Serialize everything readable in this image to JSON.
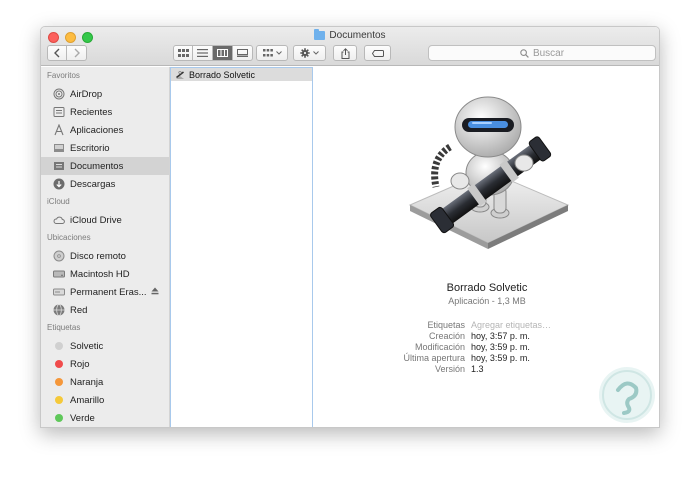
{
  "window": {
    "title": "Documentos"
  },
  "search": {
    "placeholder": "Buscar"
  },
  "sidebar": {
    "favoritos": {
      "header": "Favoritos",
      "items": [
        {
          "label": "AirDrop",
          "icon": "airdrop-icon"
        },
        {
          "label": "Recientes",
          "icon": "recents-icon"
        },
        {
          "label": "Aplicaciones",
          "icon": "applications-icon"
        },
        {
          "label": "Escritorio",
          "icon": "desktop-icon"
        },
        {
          "label": "Documentos",
          "icon": "documents-icon",
          "selected": true
        },
        {
          "label": "Descargas",
          "icon": "downloads-icon"
        }
      ]
    },
    "icloud": {
      "header": "iCloud",
      "items": [
        {
          "label": "iCloud Drive",
          "icon": "cloud-icon"
        }
      ]
    },
    "ubicaciones": {
      "header": "Ubicaciones",
      "items": [
        {
          "label": "Disco remoto",
          "icon": "disc-icon"
        },
        {
          "label": "Macintosh HD",
          "icon": "hard-drive-icon"
        },
        {
          "label": "Permanent Eras...",
          "icon": "drive-icon"
        },
        {
          "label": "Red",
          "icon": "network-icon"
        }
      ]
    },
    "etiquetas": {
      "header": "Etiquetas",
      "items": [
        {
          "label": "Solvetic",
          "color": "#d0d0d0"
        },
        {
          "label": "Rojo",
          "color": "#f04b4b"
        },
        {
          "label": "Naranja",
          "color": "#f5973a"
        },
        {
          "label": "Amarillo",
          "color": "#f5c93a"
        },
        {
          "label": "Verde",
          "color": "#5fc85a"
        }
      ]
    }
  },
  "column": {
    "items": [
      {
        "label": "Borrado Solvetic"
      }
    ]
  },
  "preview": {
    "name": "Borrado Solvetic",
    "kind": "Aplicación - 1,3 MB",
    "labels": {
      "etiquetas": "Etiquetas",
      "creacion": "Creación",
      "modificacion": "Modificación",
      "ultima_apertura": "Última apertura",
      "version": "Versión"
    },
    "values": {
      "etiquetas_placeholder": "Agregar etiquetas…",
      "creacion": "hoy, 3:57 p. m.",
      "modificacion": "hoy, 3:59 p. m.",
      "ultima_apertura": "hoy, 3:59 p. m.",
      "version": "1.3"
    }
  },
  "colors": {
    "close": "#fc605c",
    "minimize": "#fdbc40",
    "zoom": "#34c84a",
    "selection": "#a8c9ec"
  }
}
